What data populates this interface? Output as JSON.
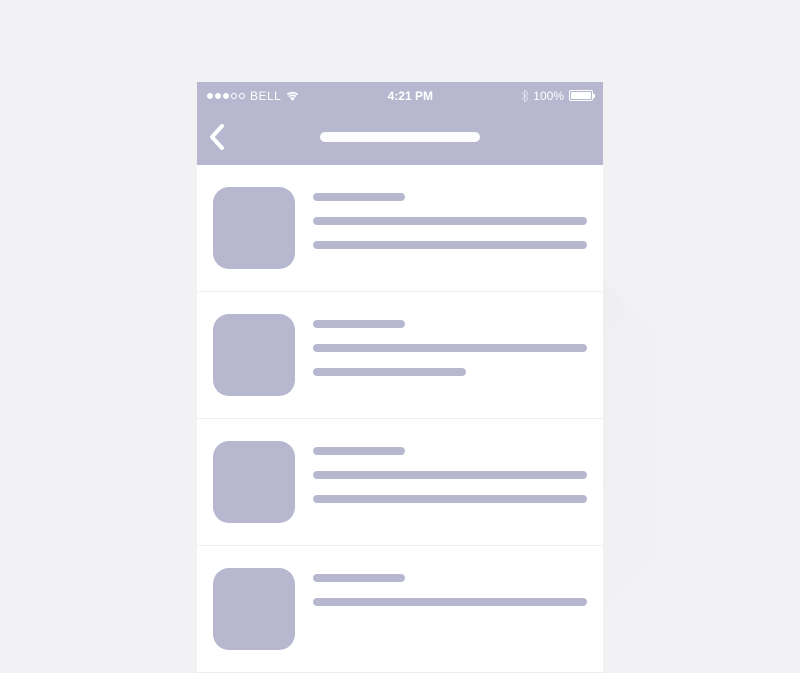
{
  "status_bar": {
    "carrier": "BELL",
    "time": "4:21 PM",
    "battery_percent": "100%"
  },
  "colors": {
    "accent": "#b7b8d0",
    "background": "#f2f2f4"
  }
}
